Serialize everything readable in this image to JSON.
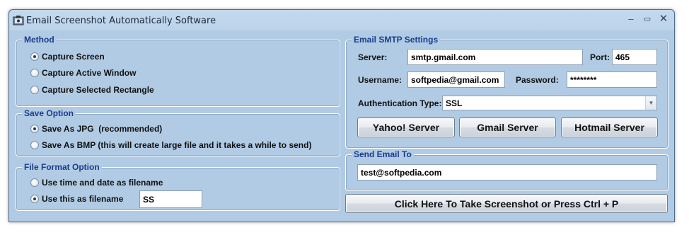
{
  "window": {
    "title": "Email Screenshot Automatically Software",
    "minimize_glyph": "–",
    "maximize_glyph": "▭",
    "close_glyph": "✕"
  },
  "method": {
    "legend": "Method",
    "options": [
      "Capture Screen",
      "Capture Active Window",
      "Capture Selected Rectangle"
    ],
    "selected": "Capture Screen"
  },
  "save_option": {
    "legend": "Save Option",
    "options": [
      "Save As JPG  (recommended)",
      "Save As BMP (this will create large file and it takes a while to send)"
    ],
    "selected": "Save As JPG  (recommended)"
  },
  "file_format": {
    "legend": "File Format Option",
    "option_time": "Use time and date as filename",
    "option_custom": "Use this as filename",
    "selected": "Use this as filename",
    "filename_value": "SS"
  },
  "smtp": {
    "legend": "Email SMTP Settings",
    "server_label": "Server:",
    "server_value": "smtp.gmail.com",
    "port_label": "Port:",
    "port_value": "465",
    "username_label": "Username:",
    "username_value": "softpedia@gmail.com",
    "password_label": "Password:",
    "password_value": "********",
    "auth_label": "Authentication Type:",
    "auth_value": "SSL",
    "yahoo_button": "Yahoo! Server",
    "gmail_button": "Gmail Server",
    "hotmail_button": "Hotmail Server"
  },
  "send_to": {
    "legend": "Send Email To",
    "email_value": "test@softpedia.com"
  },
  "action": {
    "take_screenshot_button": "Click Here To Take Screenshot or Press Ctrl + P"
  }
}
